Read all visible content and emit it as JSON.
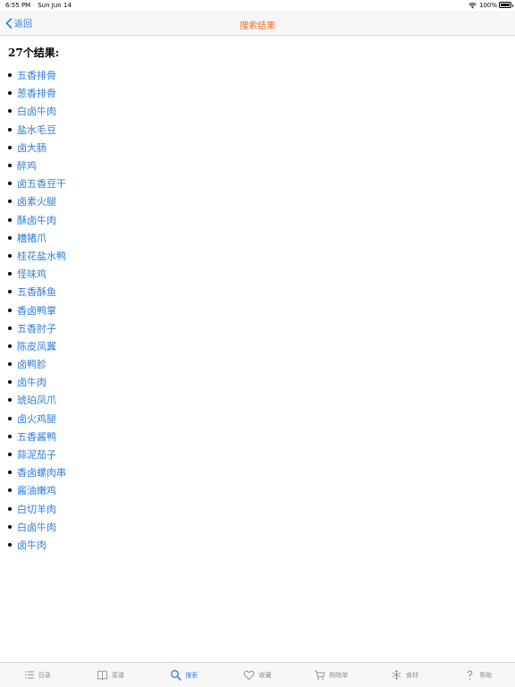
{
  "status": {
    "time": "6:55 PM",
    "date": "Sun Jun 14",
    "battery": "100%",
    "battery_level": 1.0
  },
  "nav": {
    "back_label": "返回",
    "title": "搜索结果"
  },
  "results": {
    "count_label": "27个结果:",
    "items": [
      "五香排骨",
      "葱香排骨",
      "白卤牛肉",
      "盐水毛豆",
      "卤大肠",
      "醉鸡",
      "卤五香豆干",
      "卤素火腿",
      "酥卤牛肉",
      "糟猪爪",
      "桂花盐水鸭",
      "怪味鸡",
      "五香酥鱼",
      "香卤鸭掌",
      "五香肘子",
      "陈皮凤翼",
      "卤鸭胗",
      "卤牛肉",
      "琥珀凤爪",
      "卤火鸡腿",
      "五香酱鸭",
      "蒜泥茄子",
      "香卤螺肉串",
      "酱油嫩鸡",
      "白切羊肉",
      "白卤牛肉",
      "卤牛肉"
    ]
  },
  "tabs": [
    {
      "label": "目录",
      "icon": "list-icon"
    },
    {
      "label": "菜谱",
      "icon": "book-icon"
    },
    {
      "label": "搜索",
      "icon": "search-icon",
      "active": true
    },
    {
      "label": "收藏",
      "icon": "heart-icon"
    },
    {
      "label": "购物单",
      "icon": "cart-icon"
    },
    {
      "label": "食材",
      "icon": "snowflake-icon"
    },
    {
      "label": "帮助",
      "icon": "help-icon"
    }
  ],
  "colors": {
    "accent": "#2f7de1",
    "title": "#f26b21",
    "inactive": "#8e8e93"
  }
}
